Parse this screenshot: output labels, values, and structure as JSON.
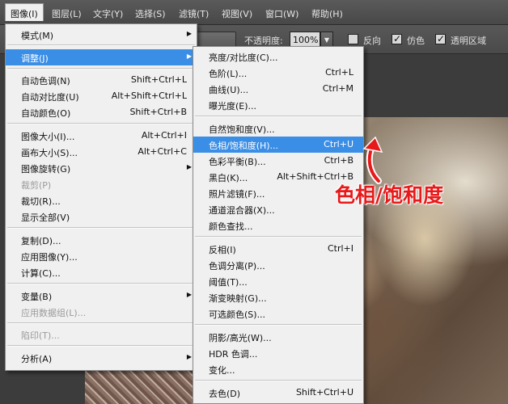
{
  "menubar": {
    "items": [
      "图像(I)",
      "图层(L)",
      "文字(Y)",
      "选择(S)",
      "滤镜(T)",
      "视图(V)",
      "窗口(W)",
      "帮助(H)"
    ]
  },
  "optionsbar": {
    "opacity_label": "不透明度:",
    "opacity_value": "100%",
    "reverse_label": "反向",
    "dither_label": "仿色",
    "transparency_label": "透明区域",
    "reverse_checked": false,
    "dither_checked": true,
    "transparency_checked": true
  },
  "image_menu": {
    "items": [
      {
        "label": "模式(M)",
        "submenu": true
      },
      {
        "label": "调整(J)",
        "submenu": true,
        "highlighted": true
      },
      {
        "label": "自动色调(N)",
        "shortcut": "Shift+Ctrl+L"
      },
      {
        "label": "自动对比度(U)",
        "shortcut": "Alt+Shift+Ctrl+L"
      },
      {
        "label": "自动颜色(O)",
        "shortcut": "Shift+Ctrl+B"
      },
      {
        "label": "图像大小(I)...",
        "shortcut": "Alt+Ctrl+I"
      },
      {
        "label": "画布大小(S)...",
        "shortcut": "Alt+Ctrl+C"
      },
      {
        "label": "图像旋转(G)",
        "submenu": true
      },
      {
        "label": "裁剪(P)",
        "disabled": true
      },
      {
        "label": "裁切(R)..."
      },
      {
        "label": "显示全部(V)"
      },
      {
        "label": "复制(D)..."
      },
      {
        "label": "应用图像(Y)..."
      },
      {
        "label": "计算(C)..."
      },
      {
        "label": "变量(B)",
        "submenu": true
      },
      {
        "label": "应用数据组(L)...",
        "disabled": true
      },
      {
        "label": "陷印(T)...",
        "disabled": true
      },
      {
        "label": "分析(A)",
        "submenu": true
      }
    ]
  },
  "adjust_menu": {
    "items": [
      {
        "label": "亮度/对比度(C)..."
      },
      {
        "label": "色阶(L)...",
        "shortcut": "Ctrl+L"
      },
      {
        "label": "曲线(U)...",
        "shortcut": "Ctrl+M"
      },
      {
        "label": "曝光度(E)..."
      },
      {
        "label": "自然饱和度(V)..."
      },
      {
        "label": "色相/饱和度(H)...",
        "shortcut": "Ctrl+U",
        "highlighted": true
      },
      {
        "label": "色彩平衡(B)...",
        "shortcut": "Ctrl+B"
      },
      {
        "label": "黑白(K)...",
        "shortcut": "Alt+Shift+Ctrl+B"
      },
      {
        "label": "照片滤镜(F)..."
      },
      {
        "label": "通道混合器(X)..."
      },
      {
        "label": "颜色查找..."
      },
      {
        "label": "反相(I)",
        "shortcut": "Ctrl+I"
      },
      {
        "label": "色调分离(P)..."
      },
      {
        "label": "阈值(T)..."
      },
      {
        "label": "渐变映射(G)..."
      },
      {
        "label": "可选颜色(S)..."
      },
      {
        "label": "阴影/高光(W)..."
      },
      {
        "label": "HDR 色调..."
      },
      {
        "label": "变化..."
      },
      {
        "label": "去色(D)",
        "shortcut": "Shift+Ctrl+U"
      }
    ]
  },
  "annotation": {
    "text": "色相/饱和度",
    "color": "#e8191a"
  },
  "colors": {
    "highlight": "#3a8ee6",
    "menu_bg": "#f0f0f0",
    "chrome_bg": "#4a4a4a"
  }
}
